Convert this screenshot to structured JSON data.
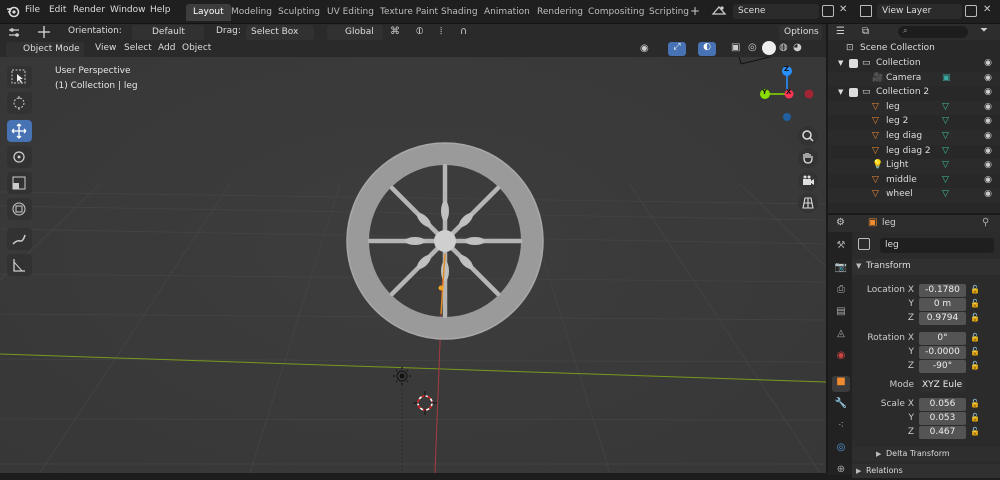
{
  "menu": [
    "File",
    "Edit",
    "Render",
    "Window",
    "Help"
  ],
  "workspaces": [
    "Layout",
    "Modeling",
    "Sculpting",
    "UV Editing",
    "Texture Paint",
    "Shading",
    "Animation",
    "Rendering",
    "Compositing",
    "Scripting"
  ],
  "active_workspace": "Layout",
  "scene": "Scene",
  "view_layer": "View Layer",
  "toolbar": {
    "orientation_label": "Orientation:",
    "orientation_value": "Default",
    "drag_label": "Drag:",
    "drag_value": "Select Box",
    "transform_value": "Global",
    "options": "Options"
  },
  "header": {
    "mode": "Object Mode",
    "view": "View",
    "select": "Select",
    "add": "Add",
    "object": "Object"
  },
  "viewport": {
    "perspective": "User Perspective",
    "collection_info": "(1) Collection | leg",
    "gizmo": {
      "x": "X",
      "y": "Y",
      "z": "Z"
    }
  },
  "outliner": {
    "title": "Scene Collection",
    "items": [
      {
        "name": "Collection",
        "level": 1,
        "type": "collection"
      },
      {
        "name": "Camera",
        "level": 2,
        "type": "camera"
      },
      {
        "name": "Collection 2",
        "level": 1,
        "type": "collection"
      },
      {
        "name": "leg",
        "level": 2,
        "type": "mesh"
      },
      {
        "name": "leg 2",
        "level": 2,
        "type": "mesh"
      },
      {
        "name": "leg diag",
        "level": 2,
        "type": "mesh"
      },
      {
        "name": "leg diag 2",
        "level": 2,
        "type": "mesh"
      },
      {
        "name": "Light",
        "level": 2,
        "type": "light"
      },
      {
        "name": "middle",
        "level": 2,
        "type": "mesh"
      },
      {
        "name": "wheel",
        "level": 2,
        "type": "mesh"
      }
    ]
  },
  "properties": {
    "object_name": "leg",
    "name_field": "leg",
    "transform_title": "Transform",
    "location": {
      "label": "Location X",
      "x": "-0.1780",
      "y": "0 m",
      "z": "0.9794"
    },
    "rotation": {
      "label": "Rotation X",
      "x": "0°",
      "y": "-0.0000",
      "z": "-90°"
    },
    "mode_label": "Mode",
    "mode_value": "XYZ Eule",
    "scale": {
      "label": "Scale X",
      "x": "0.056",
      "y": "0.053",
      "z": "0.467"
    },
    "axis_y": "Y",
    "axis_z": "Z",
    "delta": "Delta Transform",
    "relations": "Relations"
  },
  "colors": {
    "accent": "#4772b3",
    "x_axis": "#ff3352",
    "y_axis": "#8bdc00",
    "z_axis": "#2890ff"
  }
}
